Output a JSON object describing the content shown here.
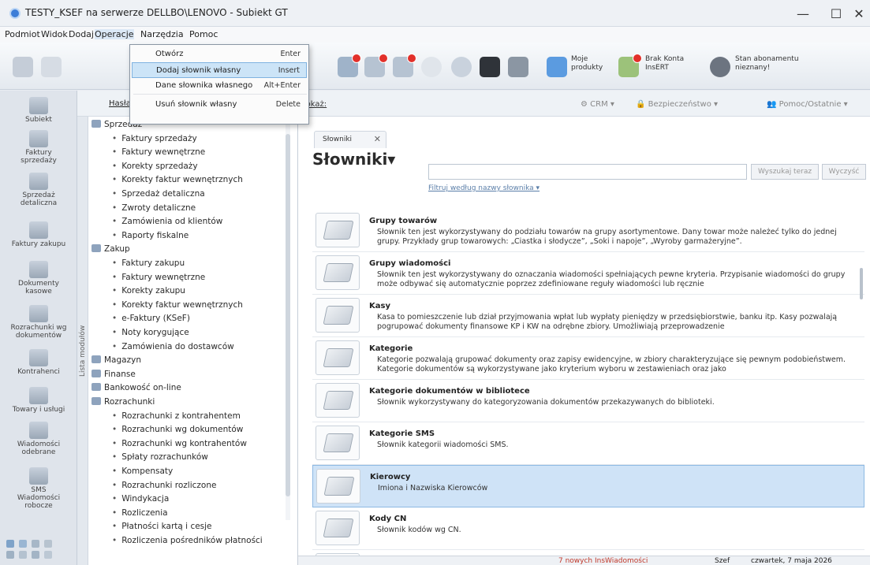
{
  "window": {
    "title": "TESTY_KSEF na serwerze DELLBO\\LENOVO - Subiekt GT",
    "minimize": "—",
    "maximize": "☐",
    "close": "✕"
  },
  "menu": [
    "Podmiot",
    "Widok",
    "Dodaj",
    "Operacje",
    "Narzędzia",
    "Pomoc"
  ],
  "toolbar": {
    "moje_produkty": "Moje\nprodukty",
    "brak_konta": "Brak Konta\nInsERT",
    "stan_abonamentu": "Stan abonamentu\nnieznany!"
  },
  "operacje_menu": [
    {
      "label": "Otwórz",
      "shortcut": "Enter"
    },
    {
      "label": "Dodaj słownik własny",
      "shortcut": "Insert"
    },
    {
      "label": "Dane słownika własnego",
      "shortcut": "Alt+Enter"
    },
    {
      "label": "Usuń słownik własny",
      "shortcut": "Delete"
    }
  ],
  "left_nav": [
    "Subiekt",
    "Faktury\nsprzedaży",
    "Sprzedaż\ndetaliczna",
    "Faktury zakupu",
    "Dokumenty\nkasowe",
    "Rozrachunki wg\ndokumentów",
    "Kontrahenci",
    "Towary i usługi",
    "Wiadomości\nodebrane",
    "SMS\nWiadomości\nrobocze"
  ],
  "tree_header": "Hasła",
  "tree_vertical_label": "Lista modułów",
  "tree": [
    {
      "type": "group",
      "label": "Sprzedaż"
    },
    {
      "type": "leaf",
      "label": "Faktury sprzedaży"
    },
    {
      "type": "leaf",
      "label": "Faktury wewnętrzne"
    },
    {
      "type": "leaf",
      "label": "Korekty sprzedaży"
    },
    {
      "type": "leaf",
      "label": "Korekty faktur wewnętrznych"
    },
    {
      "type": "leaf",
      "label": "Sprzedaż detaliczna"
    },
    {
      "type": "leaf",
      "label": "Zwroty detaliczne"
    },
    {
      "type": "leaf",
      "label": "Zamówienia od klientów"
    },
    {
      "type": "leaf",
      "label": "Raporty fiskalne"
    },
    {
      "type": "group",
      "label": "Zakup"
    },
    {
      "type": "leaf",
      "label": "Faktury zakupu"
    },
    {
      "type": "leaf",
      "label": "Faktury wewnętrzne"
    },
    {
      "type": "leaf",
      "label": "Korekty zakupu"
    },
    {
      "type": "leaf",
      "label": "Korekty faktur wewnętrznych"
    },
    {
      "type": "leaf",
      "label": "e-Faktury (KSeF)"
    },
    {
      "type": "leaf",
      "label": "Noty korygujące"
    },
    {
      "type": "leaf",
      "label": "Zamówienia do dostawców"
    },
    {
      "type": "group",
      "label": "Magazyn"
    },
    {
      "type": "group",
      "label": "Finanse"
    },
    {
      "type": "group",
      "label": "Bankowość on-line"
    },
    {
      "type": "group",
      "label": "Rozrachunki"
    },
    {
      "type": "leaf",
      "label": "Rozrachunki z kontrahentem"
    },
    {
      "type": "leaf",
      "label": "Rozrachunki wg dokumentów"
    },
    {
      "type": "leaf",
      "label": "Rozrachunki wg kontrahentów"
    },
    {
      "type": "leaf",
      "label": "Spłaty rozrachunków"
    },
    {
      "type": "leaf",
      "label": "Kompensaty"
    },
    {
      "type": "leaf",
      "label": "Rozrachunki rozliczone"
    },
    {
      "type": "leaf",
      "label": "Windykacja"
    },
    {
      "type": "leaf",
      "label": "Rozliczenia"
    },
    {
      "type": "leaf",
      "label": "Płatności kartą i cesje"
    },
    {
      "type": "leaf",
      "label": "Rozliczenia pośredników płatności"
    }
  ],
  "main_bar": {
    "link": "Pokaż:",
    "crm": "CRM",
    "bezpieczenstwo": "Bezpieczeństwo",
    "pomoc": "Pomoc/Ostatnie"
  },
  "tab": {
    "label": "Słowniki",
    "close": "✕"
  },
  "page_title": "Słowniki▾",
  "search": {
    "value": "",
    "search_btn": "Wyszukaj teraz",
    "clear_btn": "Wyczyść",
    "filter_link": "Filtruj według nazwy słownika ▾"
  },
  "dictionaries": [
    {
      "name": "Grupy towarów",
      "desc": "Słownik ten jest wykorzystywany do podziału towarów na grupy asortymentowe. Dany towar może należeć tylko do jednej grupy. Przykłady grup towarowych: „Ciastka i słodycze”, „Soki i napoje”, „Wyroby garmażeryjne”."
    },
    {
      "name": "Grupy wiadomości",
      "desc": "Słownik ten jest wykorzystywany do oznaczania wiadomości spełniających pewne kryteria. Przypisanie wiadomości do grupy może odbywać się automatycznie poprzez zdefiniowane reguły wiadomości lub ręcznie"
    },
    {
      "name": "Kasy",
      "desc": "Kasa to pomieszczenie lub dział przyjmowania wpłat lub wypłaty pieniędzy w przedsiębiorstwie, banku itp. Kasy pozwalają pogrupować dokumenty finansowe KP i KW na odrębne zbiory. Umożliwiają przeprowadzenie"
    },
    {
      "name": "Kategorie",
      "desc": "Kategorie pozwalają grupować dokumenty oraz zapisy ewidencyjne, w zbiory charakteryzujące się pewnym podobieństwem. Kategorie dokumentów są wykorzystywane jako kryterium wyboru w zestawieniach oraz jako"
    },
    {
      "name": "Kategorie dokumentów w bibliotece",
      "desc": "Słownik wykorzystywany do kategoryzowania dokumentów przekazywanych do biblioteki."
    },
    {
      "name": "Kategorie SMS",
      "desc": "Słownik kategorii wiadomości SMS."
    },
    {
      "name": "Kierowcy",
      "desc": "Imiona i Nazwiska Kierowców"
    },
    {
      "name": "Kody CN",
      "desc": "Słownik kodów wg CN."
    },
    {
      "name": "",
      "desc": ""
    }
  ],
  "status": {
    "messages": "7 nowych InsWiadomości",
    "user": "Szef",
    "date": "czwartek, 7 maja 2026"
  }
}
